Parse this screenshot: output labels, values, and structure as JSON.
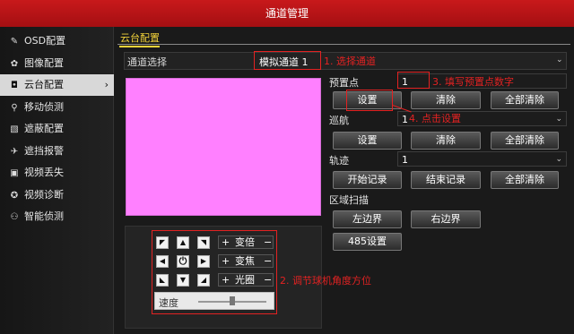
{
  "window": {
    "title": "通道管理"
  },
  "sidebar": {
    "items": [
      {
        "label": "OSD配置",
        "icon": "edit-icon",
        "glyph": "✎"
      },
      {
        "label": "图像配置",
        "icon": "palette-icon",
        "glyph": "✿"
      },
      {
        "label": "云台配置",
        "icon": "ptz-camera-icon",
        "glyph": "◘",
        "active": true
      },
      {
        "label": "移动侦测",
        "icon": "running-person-icon",
        "glyph": "⚲"
      },
      {
        "label": "遮蔽配置",
        "icon": "mask-icon",
        "glyph": "▧"
      },
      {
        "label": "遮挡报警",
        "icon": "alarm-icon",
        "glyph": "✈"
      },
      {
        "label": "视频丢失",
        "icon": "video-lost-icon",
        "glyph": "▣"
      },
      {
        "label": "视频诊断",
        "icon": "diagnosis-icon",
        "glyph": "✪"
      },
      {
        "label": "智能侦测",
        "icon": "smart-detect-icon",
        "glyph": "⚇"
      }
    ],
    "chevron": "›"
  },
  "tab": {
    "label": "云台配置"
  },
  "channel": {
    "label": "通道选择",
    "value": "模拟通道 1",
    "arrow": "⌄"
  },
  "ptz": {
    "arrows": {
      "up_left": "◤",
      "up": "▲",
      "up_right": "◥",
      "left": "◀",
      "center": "⏻",
      "right": "▶",
      "down_left": "◣",
      "down": "▼",
      "down_right": "◢"
    },
    "zoom": {
      "plus": "+",
      "label": "变倍",
      "minus": "−"
    },
    "focus": {
      "plus": "+",
      "label": "变焦",
      "minus": "−"
    },
    "iris": {
      "plus": "+",
      "label": "光圈",
      "minus": "−"
    },
    "speed_label": "速度",
    "speed_level": 0.5
  },
  "preset": {
    "label": "预置点",
    "value": "1",
    "set": "设置",
    "clear": "清除",
    "clear_all": "全部清除"
  },
  "patrol": {
    "label": "巡航",
    "value": "1",
    "set": "设置",
    "clear": "清除",
    "clear_all": "全部清除"
  },
  "pattern": {
    "label": "轨迹",
    "value": "1",
    "start": "开始记录",
    "stop": "结束记录",
    "clear_all": "全部清除"
  },
  "scan": {
    "label": "区域扫描",
    "left": "左边界",
    "right": "右边界"
  },
  "rs485": {
    "label": "485设置"
  },
  "annotations": {
    "a1": "1. 选择通道",
    "a2": "2. 调节球机角度方位",
    "a3": "3. 填写预置点数字",
    "a4": "4. 点击设置"
  },
  "colors": {
    "title_bar": "#c8191b",
    "tab_accent": "#f3d33a",
    "preview": "#ff80ff",
    "annotation": "#e32222"
  }
}
